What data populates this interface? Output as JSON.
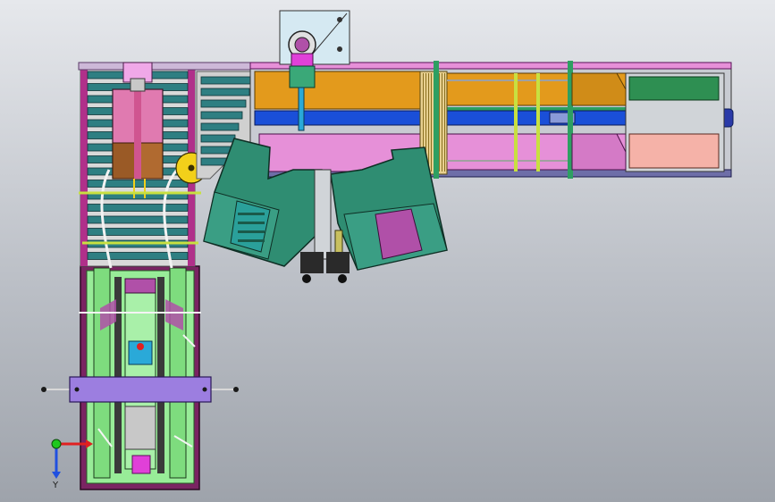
{
  "viewport": {
    "background_top": "#e6e8ec",
    "background_bottom": "#9ea3ab"
  },
  "triad": {
    "y_label": "Y",
    "x_color": "#e02020",
    "y_color": "#1ec81e",
    "z_color": "#2050e0"
  },
  "colors": {
    "frame_magenta": "#b0308a",
    "roller_teal": "#2e7f82",
    "conveyor_orange": "#e39a1c",
    "conveyor_pink": "#e690d8",
    "shaft_blue": "#1a4fd8",
    "hopper_green": "#2f8d72",
    "hopper_purple": "#b050a8",
    "lift_green": "#98ec98",
    "crossbar_purple": "#9c7ee0",
    "box_pink": "#e07ab0",
    "box_brown": "#9a5a26",
    "wheel_yellow": "#f2d01a",
    "plate_blue": "#d5e9f2",
    "base_purple": "#7a2462",
    "dark_rail": "#3a3a3a"
  }
}
